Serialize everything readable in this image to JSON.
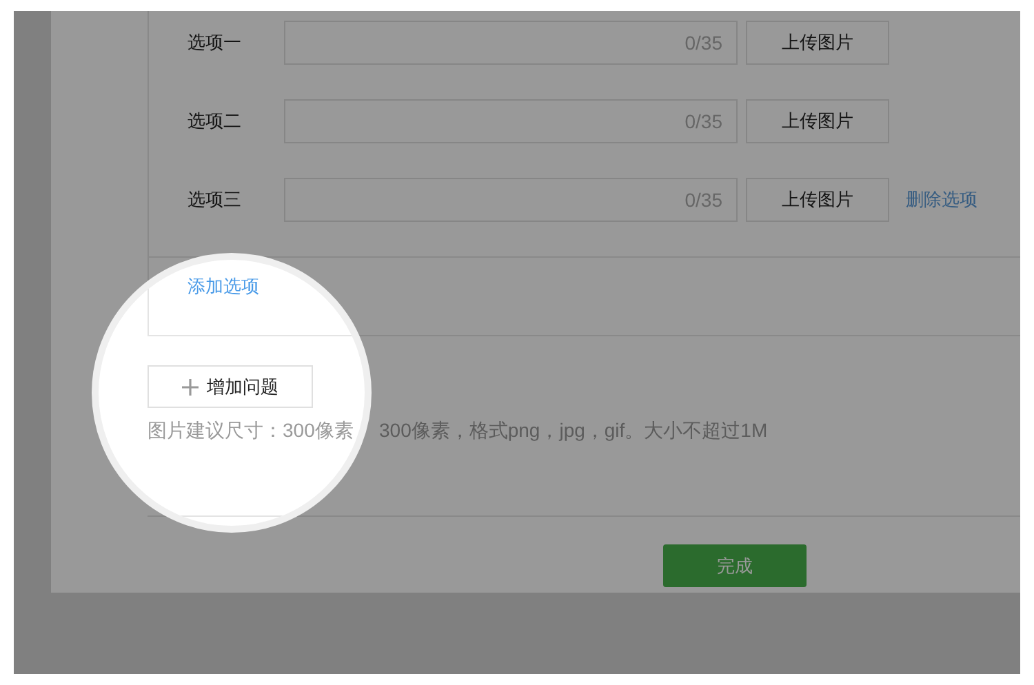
{
  "options": [
    {
      "label": "选项一",
      "counter": "0/35",
      "upload": "上传图片"
    },
    {
      "label": "选项二",
      "counter": "0/35",
      "upload": "上传图片"
    },
    {
      "label": "选项三",
      "counter": "0/35",
      "upload": "上传图片",
      "delete": "删除选项"
    }
  ],
  "add_option": "添加选项",
  "add_question": "增加问题",
  "hint": [
    "图片建议尺寸：300像素",
    "300像素，格式png，jpg，gif。大小不超过1M"
  ],
  "finish": "完成"
}
